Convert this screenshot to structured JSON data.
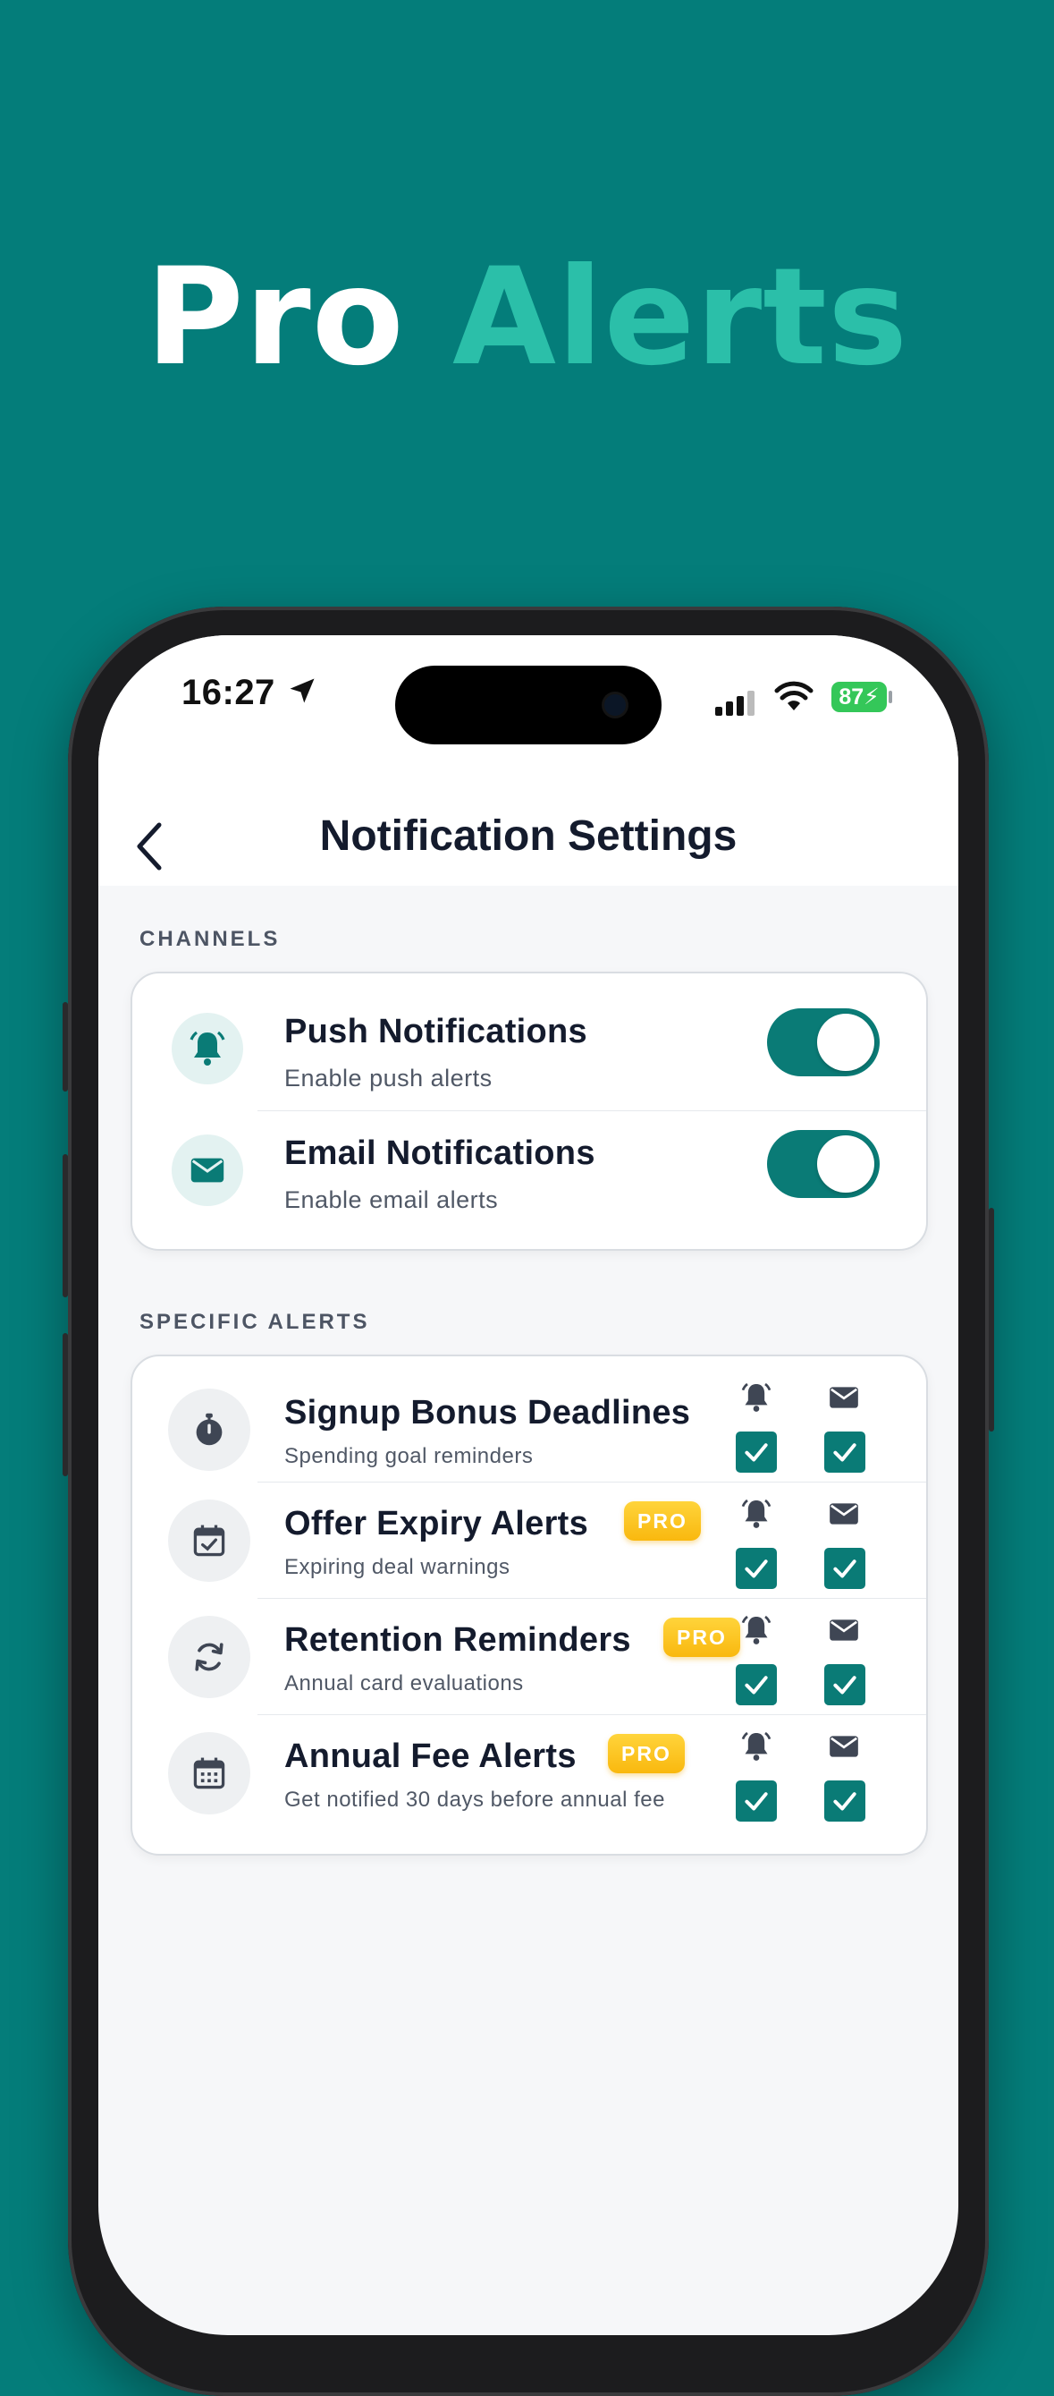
{
  "headline": {
    "word1": "Pro",
    "word2": "Alerts"
  },
  "colors": {
    "background": "#047d7a",
    "accent": "#2bbfa9",
    "toggle_on": "#0a7b76",
    "pro_badge": "#fbc21f"
  },
  "status_bar": {
    "time": "16:27",
    "battery": "87"
  },
  "nav": {
    "title": "Notification Settings",
    "back_icon": "chevron-left-icon"
  },
  "channels": {
    "label": "CHANNELS",
    "items": [
      {
        "title": "Push Notifications",
        "subtitle": "Enable push alerts",
        "icon": "bell-icon",
        "enabled": true
      },
      {
        "title": "Email Notifications",
        "subtitle": "Enable email alerts",
        "icon": "envelope-icon",
        "enabled": true
      }
    ]
  },
  "specific_alerts": {
    "label": "SPECIFIC ALERTS",
    "items": [
      {
        "title": "Signup Bonus Deadlines",
        "subtitle": "Spending goal reminders",
        "icon": "stopwatch-icon",
        "pro": false,
        "push": true,
        "email": true
      },
      {
        "title": "Offer Expiry Alerts",
        "subtitle": "Expiring deal warnings",
        "icon": "calendar-check-icon",
        "pro": true,
        "pro_label": "PRO",
        "push": true,
        "email": true
      },
      {
        "title": "Retention Reminders",
        "subtitle": "Annual card evaluations",
        "icon": "refresh-icon",
        "pro": true,
        "pro_label": "PRO",
        "push": true,
        "email": true
      },
      {
        "title": "Annual Fee Alerts",
        "subtitle": "Get notified 30 days before annual fee",
        "icon": "calendar-icon",
        "pro": true,
        "pro_label": "PRO",
        "push": true,
        "email": true
      }
    ]
  }
}
